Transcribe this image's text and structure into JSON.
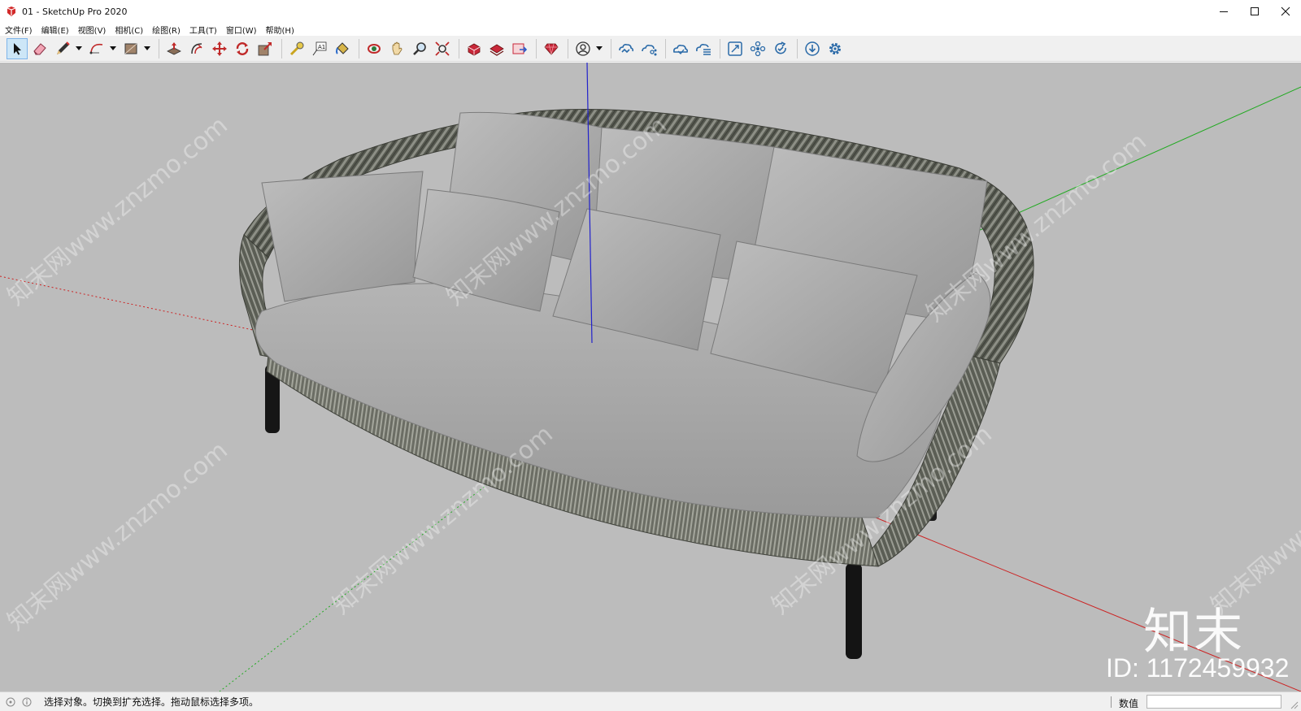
{
  "window": {
    "title": "01 - SketchUp Pro 2020",
    "controls": [
      "minimize",
      "maximize",
      "close"
    ]
  },
  "menu": {
    "items": [
      "文件(F)",
      "编辑(E)",
      "视图(V)",
      "相机(C)",
      "绘图(R)",
      "工具(T)",
      "窗口(W)",
      "帮助(H)"
    ]
  },
  "toolbar": {
    "tools": [
      {
        "name": "select",
        "icon": "select-arrow-icon",
        "active": true
      },
      {
        "name": "eraser",
        "icon": "eraser-icon"
      },
      {
        "name": "line",
        "icon": "pencil-icon"
      },
      {
        "name": "arc",
        "icon": "arc-icon"
      },
      {
        "name": "rectangle",
        "icon": "rectangle-icon"
      },
      {
        "name": "push-pull",
        "icon": "push-pull-icon"
      },
      {
        "name": "offset",
        "icon": "offset-icon"
      },
      {
        "name": "move",
        "icon": "move-icon"
      },
      {
        "name": "rotate",
        "icon": "rotate-icon"
      },
      {
        "name": "scale",
        "icon": "scale-icon"
      },
      {
        "name": "tape-measure",
        "icon": "tape-measure-icon"
      },
      {
        "name": "text",
        "icon": "text-icon"
      },
      {
        "name": "paint-bucket",
        "icon": "paint-bucket-icon"
      },
      {
        "name": "orbit",
        "icon": "orbit-icon"
      },
      {
        "name": "pan",
        "icon": "pan-hand-icon"
      },
      {
        "name": "zoom",
        "icon": "zoom-icon"
      },
      {
        "name": "zoom-extents",
        "icon": "zoom-extents-icon"
      },
      {
        "name": "3d-warehouse",
        "icon": "warehouse-icon"
      },
      {
        "name": "extension-warehouse",
        "icon": "extension-warehouse-icon"
      },
      {
        "name": "send-to-layout",
        "icon": "layout-icon"
      },
      {
        "name": "extension-manager",
        "icon": "ruby-gem-icon"
      },
      {
        "name": "account",
        "icon": "user-account-icon"
      },
      {
        "name": "trimble-connect",
        "icon": "cloud-sync-icon"
      },
      {
        "name": "collaborate",
        "icon": "cloud-share-icon"
      },
      {
        "name": "cloud-open",
        "icon": "cloud-open-icon"
      },
      {
        "name": "cloud-list",
        "icon": "cloud-list-icon"
      },
      {
        "name": "fit-view",
        "icon": "fit-view-icon"
      },
      {
        "name": "components",
        "icon": "components-icon"
      },
      {
        "name": "refresh",
        "icon": "refresh-check-icon"
      },
      {
        "name": "download",
        "icon": "download-icon"
      },
      {
        "name": "settings",
        "icon": "gear-icon"
      }
    ]
  },
  "watermark": {
    "logo": "知末",
    "id": "ID: 1172459932",
    "site": "知末网www.znzmo.com"
  },
  "status": {
    "message": "选择对象。切换到扩充选择。拖动鼠标选择多项。",
    "measurements_label": "数值",
    "measurements_value": ""
  },
  "colors": {
    "viewport_bg": "#bcbcbc",
    "axis_red": "#cc2222",
    "axis_green": "#22aa22",
    "axis_blue": "#2222cc",
    "fabric": "#a9a9a9",
    "rope_frame": "#5e6158"
  }
}
